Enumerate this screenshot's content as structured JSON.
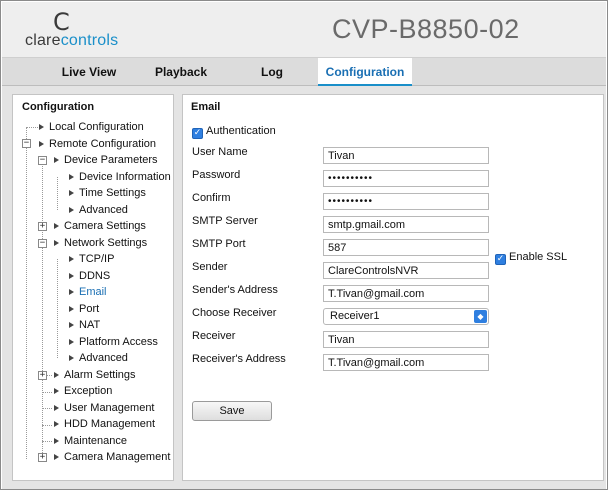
{
  "header": {
    "logo_c": "C",
    "logo_text_a": "clare",
    "logo_text_b": "controls",
    "model": "CVP-B8850-02"
  },
  "nav": {
    "tabs": [
      "Live View",
      "Playback",
      "Log",
      "Configuration"
    ],
    "active": "Configuration"
  },
  "sidebar": {
    "title": "Configuration",
    "items": [
      "Local Configuration",
      "Remote Configuration",
      "Device Parameters",
      "Device Information",
      "Time Settings",
      "Advanced",
      "Camera Settings",
      "Network Settings",
      "TCP/IP",
      "DDNS",
      "Email",
      "Port",
      "NAT",
      "Platform Access",
      "Advanced",
      "Alarm Settings",
      "Exception",
      "User Management",
      "HDD Management",
      "Maintenance",
      "Camera Management"
    ],
    "selected": "Email"
  },
  "panel": {
    "title": "Email",
    "authentication_label": "Authentication",
    "authentication_checked": true,
    "fields": {
      "user_name": {
        "label": "User Name",
        "value": "Tivan"
      },
      "password": {
        "label": "Password",
        "value": "••••••••••"
      },
      "confirm": {
        "label": "Confirm",
        "value": "••••••••••"
      },
      "smtp_server": {
        "label": "SMTP Server",
        "value": "smtp.gmail.com"
      },
      "smtp_port": {
        "label": "SMTP Port",
        "value": "587"
      },
      "sender": {
        "label": "Sender",
        "value": "ClareControlsNVR"
      },
      "senders_address": {
        "label": "Sender's Address",
        "value": "T.Tivan@gmail.com"
      },
      "choose_receiver": {
        "label": "Choose Receiver",
        "value": "Receiver1"
      },
      "receiver": {
        "label": "Receiver",
        "value": "Tivan"
      },
      "receivers_address": {
        "label": "Receiver's Address",
        "value": "T.Tivan@gmail.com"
      }
    },
    "enable_ssl_label": "Enable SSL",
    "enable_ssl_checked": true,
    "save_label": "Save"
  },
  "colors": {
    "accent": "#1a8fc9",
    "checkbox": "#2f7fe0",
    "header_bg": "#eeeeee",
    "nav_bg": "#dcdcdc",
    "content_bg": "#e4e4e4"
  }
}
